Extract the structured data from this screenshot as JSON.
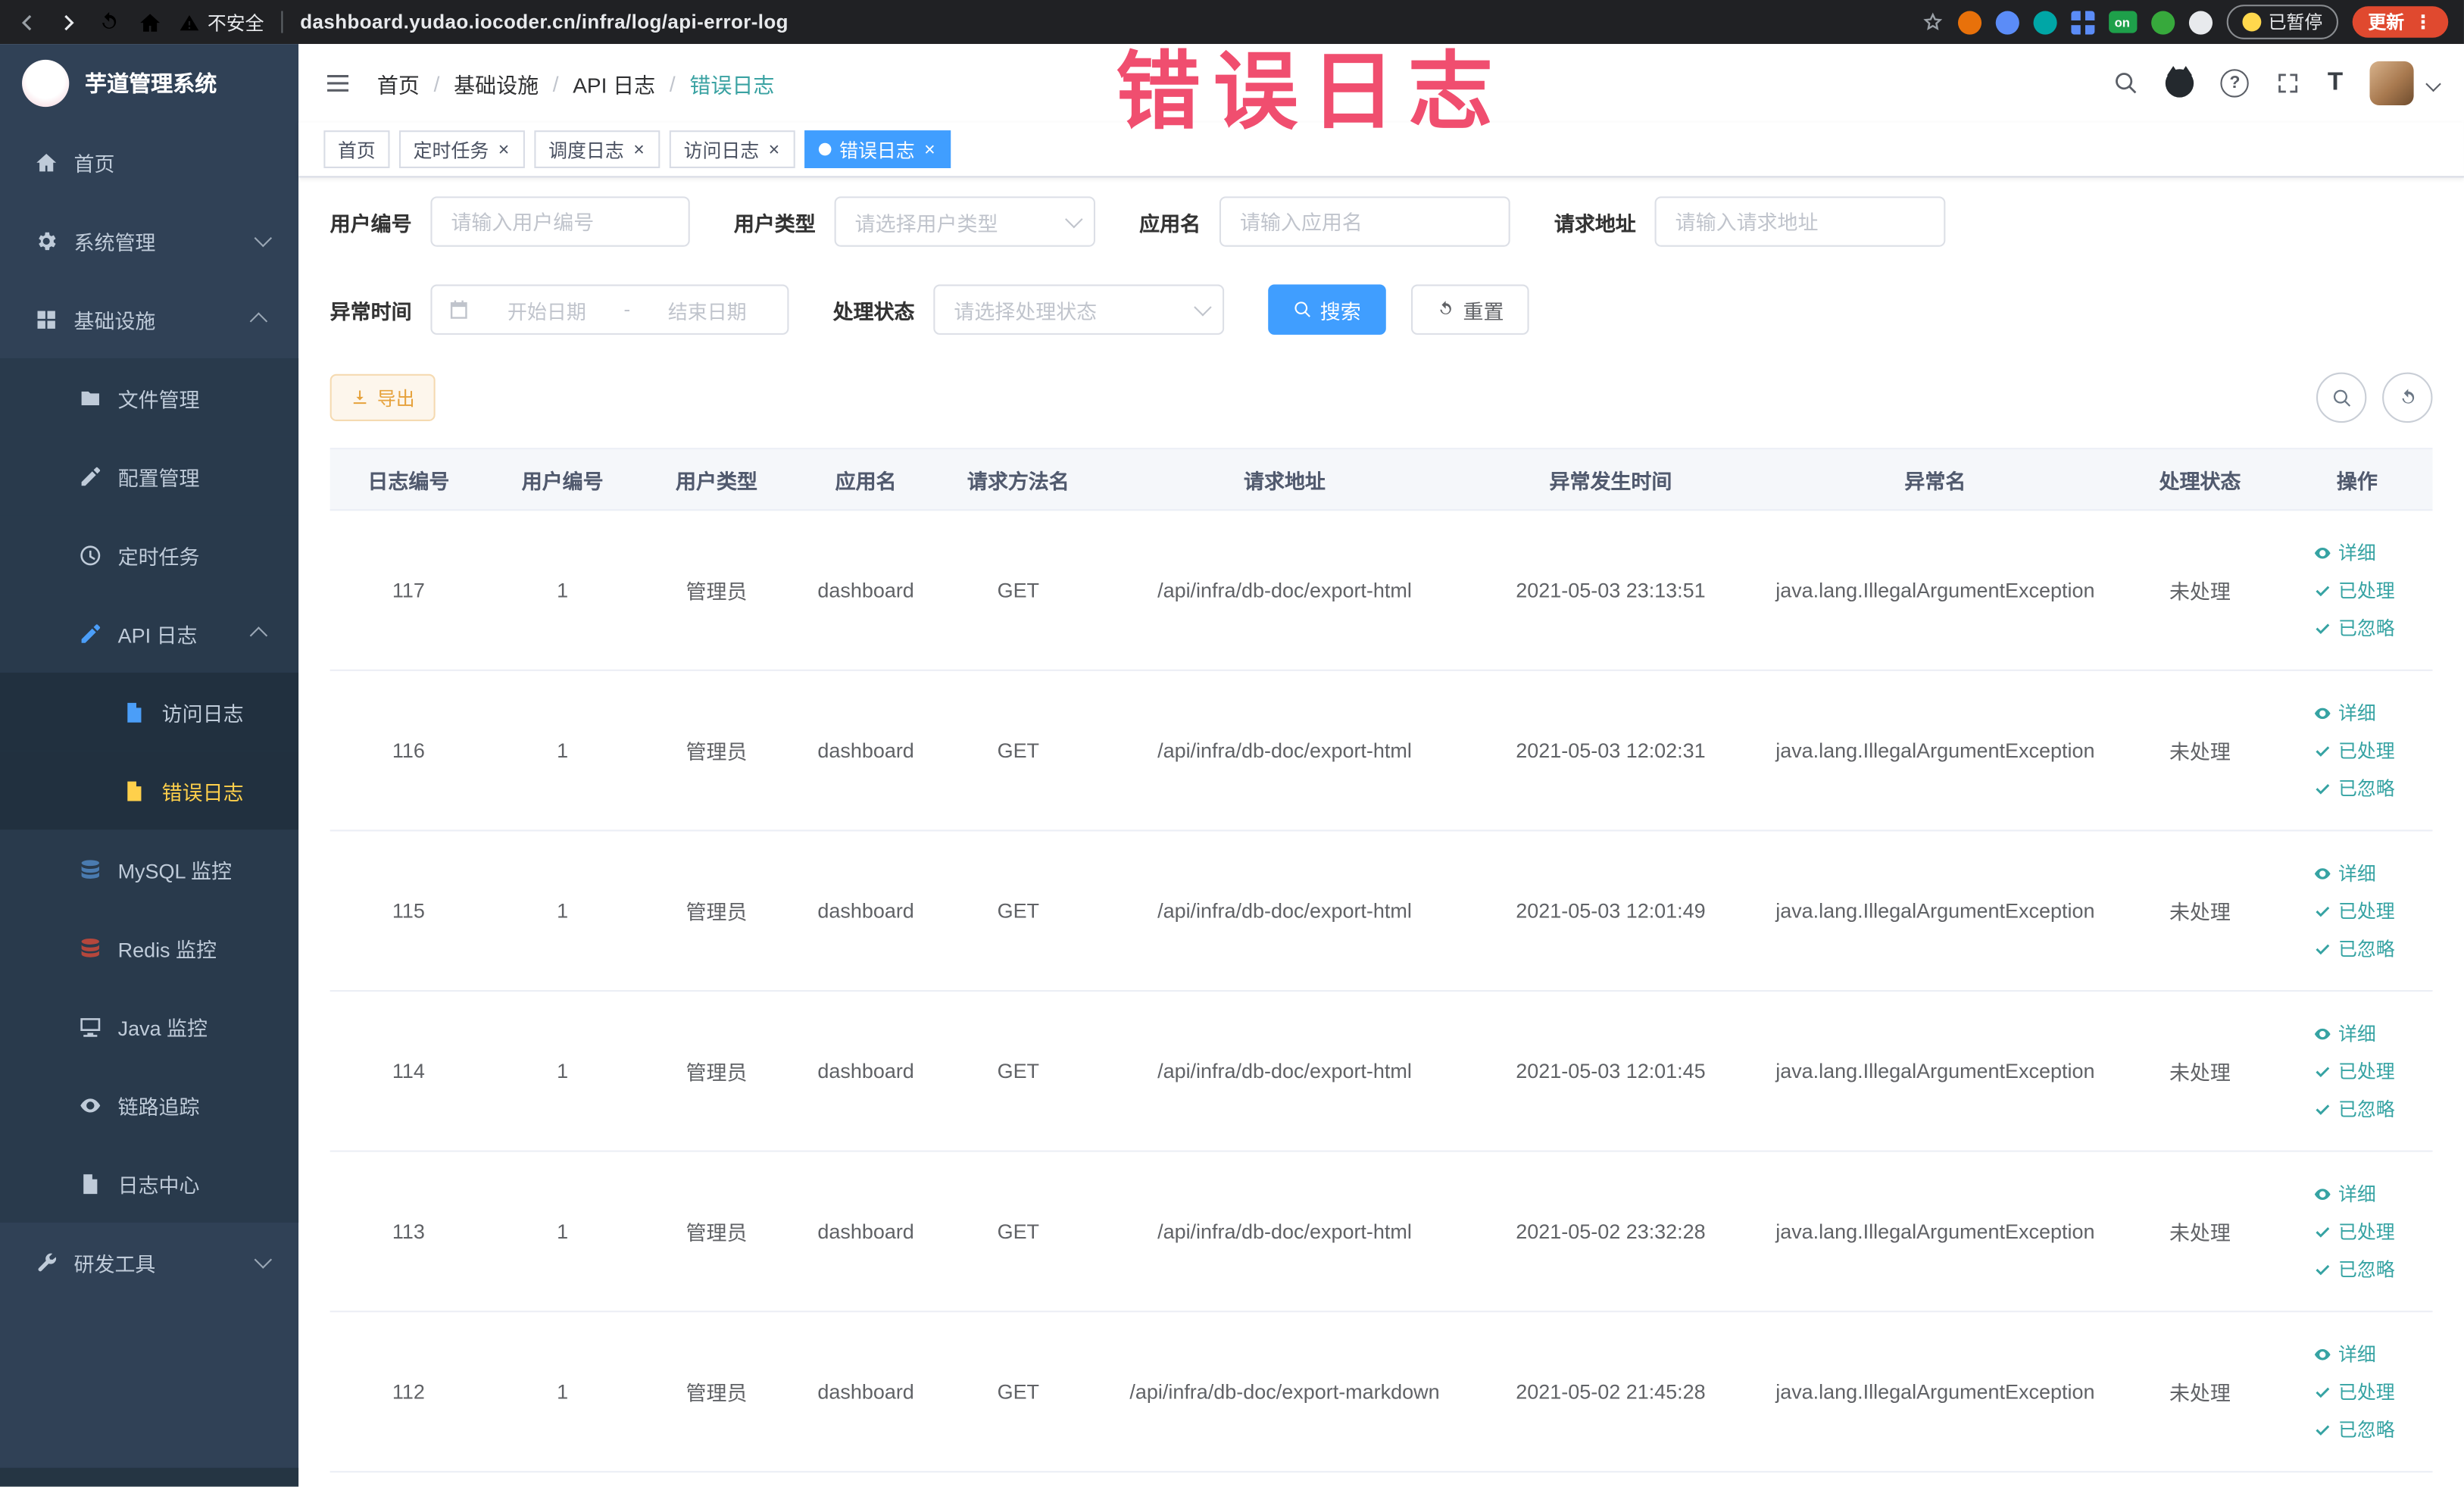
{
  "watermark": "错误日志",
  "icons": {
    "sep": "/",
    "close": "×",
    "more": "⋮",
    "help": "?",
    "font_size": "T"
  },
  "browser": {
    "security_label": "不安全",
    "url": "dashboard.yudao.iocoder.cn/infra/log/api-error-log",
    "on_badge": "on",
    "paused_label": "已暂停",
    "update_label": "更新"
  },
  "sidebar": {
    "title": "芋道管理系统",
    "items": [
      "首页",
      "系统管理",
      "基础设施",
      "文件管理",
      "配置管理",
      "定时任务",
      "API 日志",
      "访问日志",
      "错误日志",
      "MySQL 监控",
      "Redis 监控",
      "Java 监控",
      "链路追踪",
      "日志中心",
      "研发工具"
    ]
  },
  "breadcrumb": [
    "首页",
    "基础设施",
    "API 日志",
    "错误日志"
  ],
  "tabs": [
    {
      "label": "首页",
      "closable": false,
      "active": false
    },
    {
      "label": "定时任务",
      "closable": true,
      "active": false
    },
    {
      "label": "调度日志",
      "closable": true,
      "active": false
    },
    {
      "label": "访问日志",
      "closable": true,
      "active": false
    },
    {
      "label": "错误日志",
      "closable": true,
      "active": true
    }
  ],
  "filters": {
    "user_id": {
      "label": "用户编号",
      "placeholder": "请输入用户编号"
    },
    "user_type": {
      "label": "用户类型",
      "placeholder": "请选择用户类型"
    },
    "app_name": {
      "label": "应用名",
      "placeholder": "请输入应用名"
    },
    "request_url": {
      "label": "请求地址",
      "placeholder": "请输入请求地址"
    },
    "exception_time": {
      "label": "异常时间",
      "start_placeholder": "开始日期",
      "separator": "-",
      "end_placeholder": "结束日期"
    },
    "process_status": {
      "label": "处理状态",
      "placeholder": "请选择处理状态"
    },
    "search_label": "搜索",
    "reset_label": "重置"
  },
  "toolbar": {
    "export_label": "导出"
  },
  "table": {
    "columns": [
      "日志编号",
      "用户编号",
      "用户类型",
      "应用名",
      "请求方法名",
      "请求地址",
      "异常发生时间",
      "异常名",
      "处理状态",
      "操作"
    ],
    "action_labels": [
      "详细",
      "已处理",
      "已忽略"
    ],
    "rows": [
      {
        "id": "117",
        "user_id": "1",
        "user_type": "管理员",
        "app_name": "dashboard",
        "method": "GET",
        "url": "/api/infra/db-doc/export-html",
        "time": "2021-05-03 23:13:51",
        "exception": "java.lang.IllegalArgumentException",
        "status": "未处理"
      },
      {
        "id": "116",
        "user_id": "1",
        "user_type": "管理员",
        "app_name": "dashboard",
        "method": "GET",
        "url": "/api/infra/db-doc/export-html",
        "time": "2021-05-03 12:02:31",
        "exception": "java.lang.IllegalArgumentException",
        "status": "未处理"
      },
      {
        "id": "115",
        "user_id": "1",
        "user_type": "管理员",
        "app_name": "dashboard",
        "method": "GET",
        "url": "/api/infra/db-doc/export-html",
        "time": "2021-05-03 12:01:49",
        "exception": "java.lang.IllegalArgumentException",
        "status": "未处理"
      },
      {
        "id": "114",
        "user_id": "1",
        "user_type": "管理员",
        "app_name": "dashboard",
        "method": "GET",
        "url": "/api/infra/db-doc/export-html",
        "time": "2021-05-03 12:01:45",
        "exception": "java.lang.IllegalArgumentException",
        "status": "未处理"
      },
      {
        "id": "113",
        "user_id": "1",
        "user_type": "管理员",
        "app_name": "dashboard",
        "method": "GET",
        "url": "/api/infra/db-doc/export-html",
        "time": "2021-05-02 23:32:28",
        "exception": "java.lang.IllegalArgumentException",
        "status": "未处理"
      },
      {
        "id": "112",
        "user_id": "1",
        "user_type": "管理员",
        "app_name": "dashboard",
        "method": "GET",
        "url": "/api/infra/db-doc/export-markdown",
        "time": "2021-05-02 21:45:28",
        "exception": "java.lang.IllegalArgumentException",
        "status": "未处理"
      }
    ]
  },
  "colors": {
    "primary": "#409eff",
    "action_link": "#36a3a3",
    "menu_active": "#ffd04b",
    "warning": "#e6a23c",
    "watermark": "#ee3b5f"
  }
}
